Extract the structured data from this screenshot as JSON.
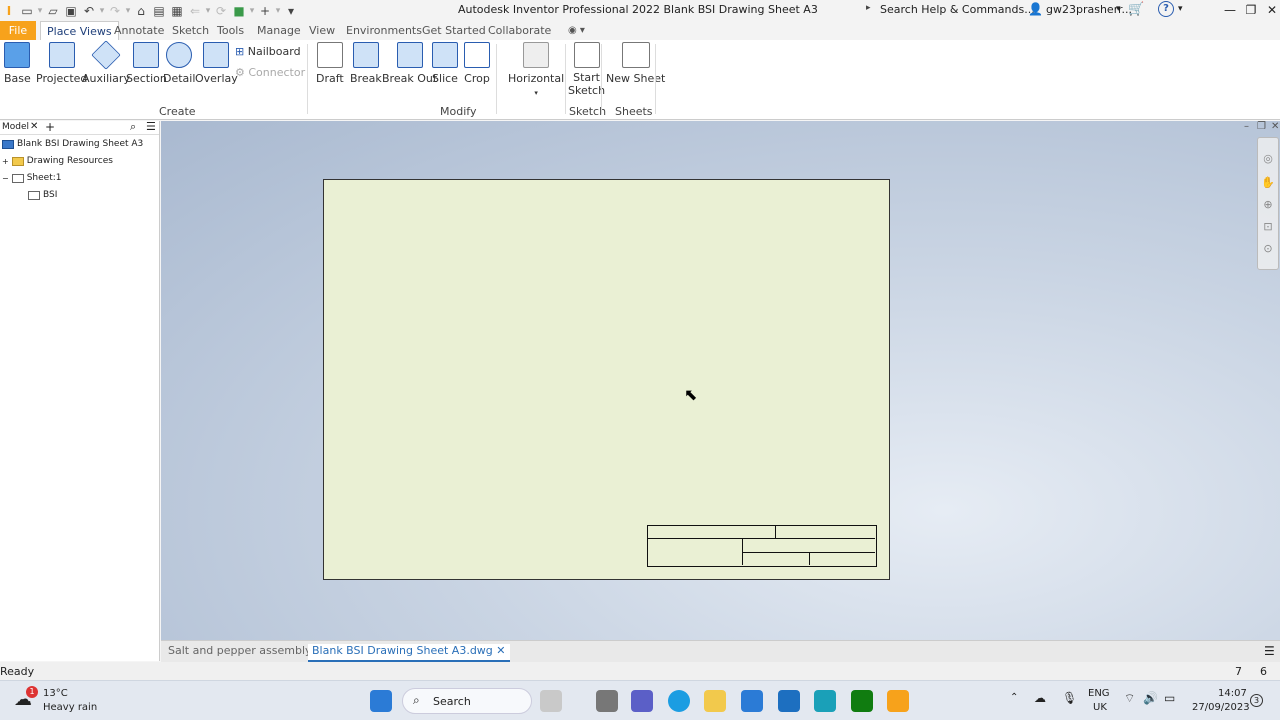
{
  "app": {
    "title": "Autodesk Inventor Professional 2022   Blank BSI Drawing Sheet A3",
    "search_help": "Search Help & Commands...",
    "user": "gw23prasherr...",
    "help_glyph": "?"
  },
  "quick_access_icons": [
    "app-logo-icon",
    "new-icon",
    "open-icon",
    "save-icon",
    "undo-icon",
    "redo-icon",
    "home-icon",
    "project-icon",
    "print-icon",
    "return-icon",
    "update-icon",
    "appearance-icon",
    "add-icon",
    "customize-icon"
  ],
  "menu_tabs": [
    {
      "label": "File"
    },
    {
      "label": "Place Views"
    },
    {
      "label": "Annotate"
    },
    {
      "label": "Sketch"
    },
    {
      "label": "Tools"
    },
    {
      "label": "Manage"
    },
    {
      "label": "View"
    },
    {
      "label": "Environments"
    },
    {
      "label": "Get Started"
    },
    {
      "label": "Collaborate"
    }
  ],
  "ribbon": {
    "create": {
      "label": "Create",
      "buttons": [
        "Base",
        "Projected",
        "Auxiliary",
        "Section",
        "Detail",
        "Overlay"
      ],
      "small": [
        "Nailboard",
        "Connector"
      ]
    },
    "modify": {
      "label": "Modify",
      "buttons": [
        "Draft",
        "Break",
        "Break Out",
        "Slice",
        "Crop",
        "Horizontal"
      ]
    },
    "sketch": {
      "label": "Sketch",
      "buttons": [
        "Start\nSketch"
      ],
      "line1": "Start",
      "line2": "Sketch"
    },
    "sheets": {
      "label": "Sheets",
      "buttons": [
        "New Sheet"
      ]
    }
  },
  "browser": {
    "tab_label": "Model",
    "items": [
      {
        "label": "Blank BSI Drawing Sheet A3"
      },
      {
        "label": "Drawing Resources"
      },
      {
        "label": "Sheet:1"
      },
      {
        "label": "BSI"
      }
    ]
  },
  "doc_tabs": [
    {
      "label": "Salt and pepper assembly.iam"
    },
    {
      "label": "Blank BSI Drawing Sheet A3.dwg"
    }
  ],
  "status": {
    "text": "Ready",
    "count_a": "7",
    "count_b": "6"
  },
  "taskbar": {
    "weather_temp": "13°C",
    "weather_desc": "Heavy rain",
    "weather_badge": "1",
    "search": "Search",
    "lang1": "ENG",
    "lang2": "UK",
    "time": "14:07",
    "date": "27/09/2023",
    "notif": "3"
  },
  "colors": {
    "accent": "#f7a21b",
    "sheet": "#eaf0d4",
    "link": "#2a6fb8"
  }
}
